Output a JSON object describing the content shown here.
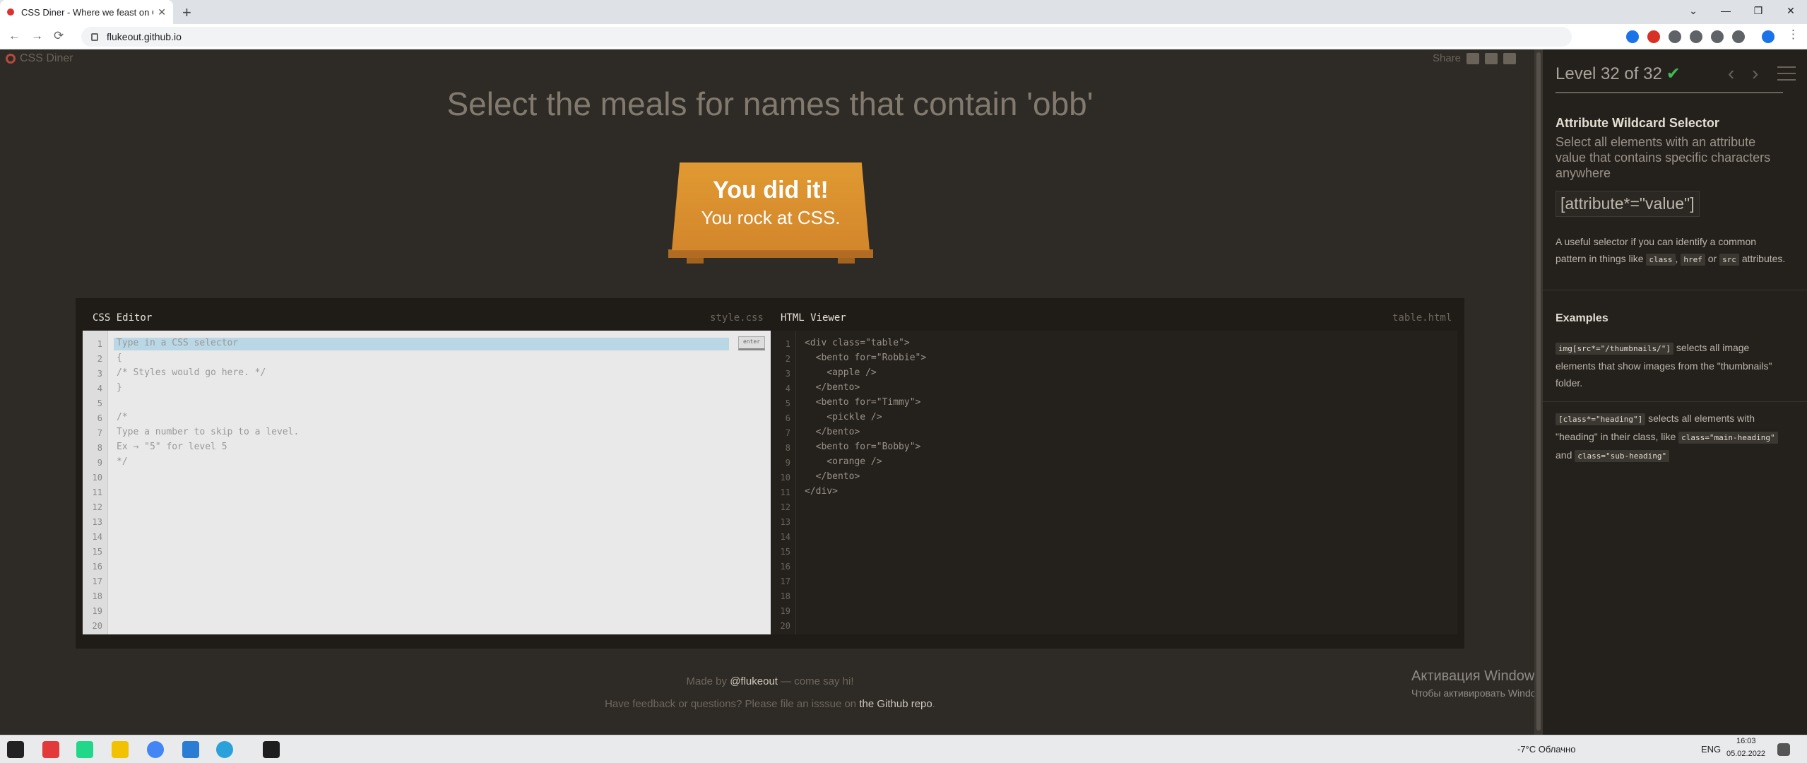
{
  "browser": {
    "tab_title": "CSS Diner - Where we feast on C",
    "close_tab": "✕",
    "new_tab": "+",
    "url": "flukeout.github.io",
    "nav": {
      "back": "←",
      "forward": "→",
      "reload": "⟳"
    },
    "window_controls": {
      "collapse": "⌄",
      "minimize": "—",
      "maximize": "❐",
      "close": "✕"
    }
  },
  "page": {
    "logo": "CSS Diner",
    "share_label": "Share",
    "heading": "Select the meals for names that contain 'obb'",
    "plate": {
      "line1": "You did it!",
      "line2": "You rock at CSS."
    },
    "css_editor": {
      "title": "CSS Editor",
      "file": "style.css",
      "enter_label": "enter",
      "lines": [
        "Type in a CSS selector",
        "{",
        "/* Styles would go here. */",
        "}",
        "",
        "/*",
        "Type a number to skip to a level.",
        "Ex → \"5\" for level 5",
        "*/"
      ],
      "line_numbers": [
        "1",
        "2",
        "3",
        "4",
        "5",
        "6",
        "7",
        "8",
        "9",
        "10",
        "11",
        "12",
        "13",
        "14",
        "15",
        "16",
        "17",
        "18",
        "19",
        "20"
      ]
    },
    "html_viewer": {
      "title": "HTML Viewer",
      "file": "table.html",
      "lines": [
        "<div class=\"table\">",
        "  <bento for=\"Robbie\">",
        "    <apple />",
        "  </bento>",
        "  <bento for=\"Timmy\">",
        "    <pickle />",
        "  </bento>",
        "  <bento for=\"Bobby\">",
        "    <orange />",
        "  </bento>",
        "</div>"
      ]
    },
    "footer": {
      "made_by_prefix": "Made by",
      "made_by_handle": "@flukeout",
      "made_by_suffix": "— come say hi!",
      "feedback_prefix": "Have feedback or questions? Please file an isssue on",
      "feedback_link": "the Github repo",
      "feedback_suffix": "."
    },
    "activation": {
      "title": "Активация Windows",
      "text": "Чтобы активировать Windows, перейдите в раздел \"Параметры\"."
    }
  },
  "sidebar": {
    "level": "Level 32 of 32",
    "check": "✔",
    "prev": "‹",
    "next": "›",
    "selector_name": "Attribute Wildcard Selector",
    "description": "Select all elements with an attribute value that contains specific characters anywhere",
    "syntax": "[attribute*=\"value\"]",
    "useful_prefix": "A useful selector if you can identify a common pattern in things like",
    "useful_codes": [
      "class",
      "href",
      "src"
    ],
    "useful_or": "or",
    "useful_comma": ",",
    "useful_suffix": "attributes.",
    "examples_heading": "Examples",
    "example1_code": "img[src*=\"/thumbnails/\"]",
    "example1_text": "selects all image elements that show images from the \"thumbnails\" folder.",
    "example2_code": "[class*=\"heading\"]",
    "example2_text": "selects all elements with \"heading\" in their class, like",
    "example2_code2": "class=\"main-heading\"",
    "example2_and": "and",
    "example2_code3": "class=\"sub-heading\""
  },
  "taskbar": {
    "weather": "-7°C Облачно",
    "lang": "ENG",
    "time": "16:03",
    "date": "05.02.2022"
  }
}
